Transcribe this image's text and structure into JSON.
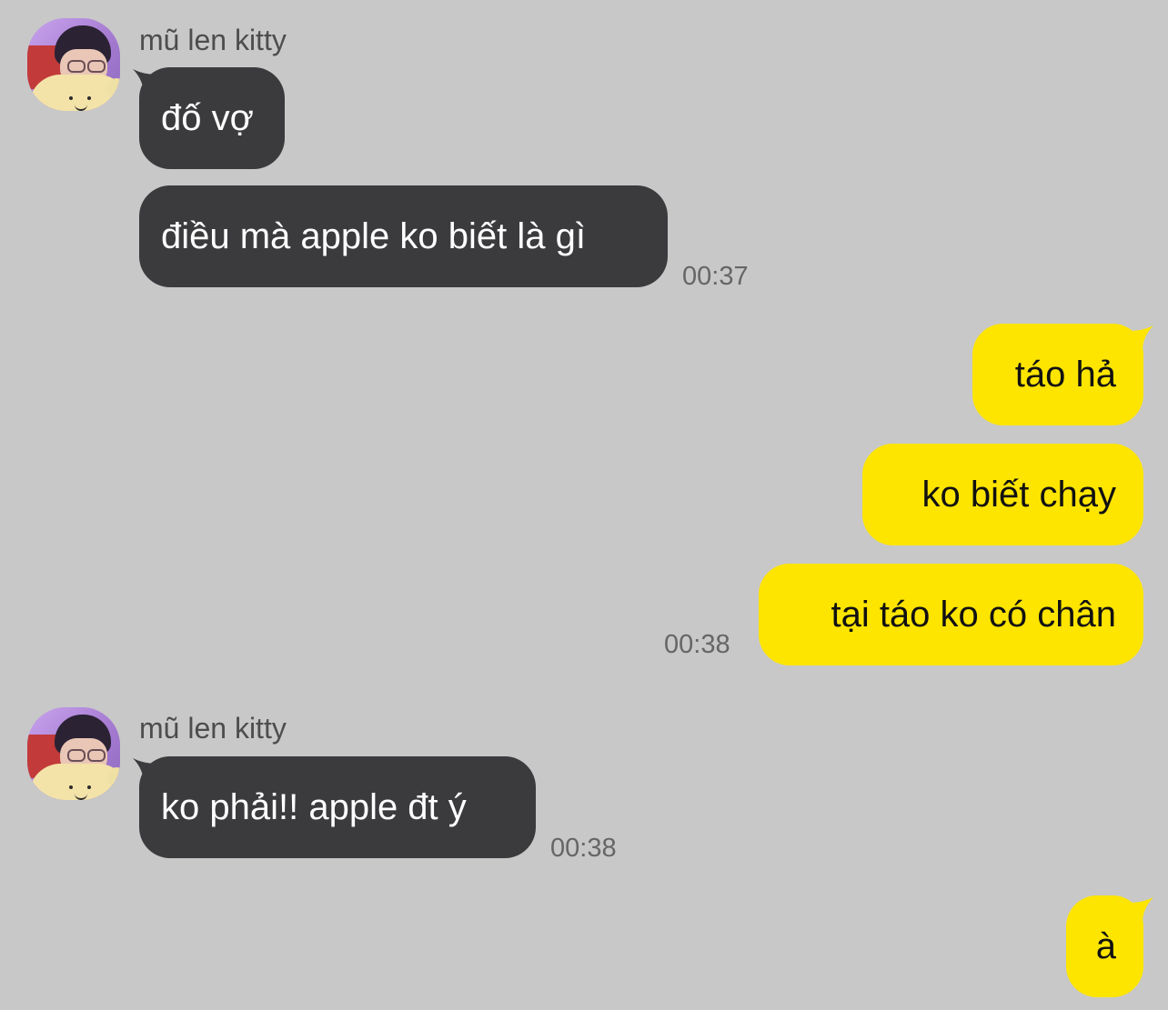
{
  "colors": {
    "background": "#c8c8c8",
    "incoming_bubble": "#3b3b3e",
    "incoming_text": "#ffffff",
    "outgoing_bubble": "#fee500",
    "outgoing_text": "#111111",
    "meta_text": "#666666"
  },
  "messages": {
    "group1": {
      "sender": "mũ len kitty",
      "bubbles": [
        "đố vợ",
        "điều mà apple ko biết là gì"
      ],
      "time": "00:37"
    },
    "group2": {
      "bubbles": [
        "táo hả",
        "ko biết chạy",
        "tại táo ko có chân"
      ],
      "time": "00:38"
    },
    "group3": {
      "sender": "mũ len kitty",
      "bubbles": [
        "ko phải!! apple đt ý"
      ],
      "time": "00:38"
    },
    "group4": {
      "bubbles": [
        "à"
      ]
    }
  }
}
